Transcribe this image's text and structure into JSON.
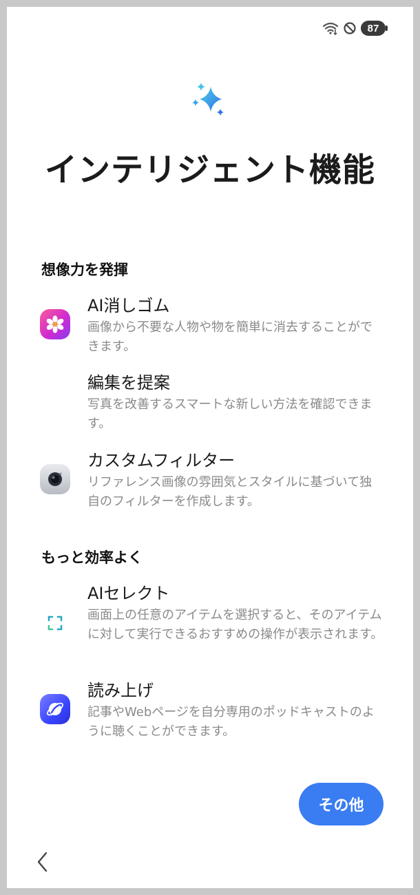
{
  "status_bar": {
    "battery_level": "87",
    "icons": [
      "wifi-icon",
      "do-not-disturb-icon",
      "battery-icon"
    ]
  },
  "header": {
    "title": "インテリジェント機能",
    "icon": "sparkle-icon"
  },
  "sections": [
    {
      "heading": "想像力を発揮",
      "items": [
        {
          "title": "AI消しゴム",
          "description": "画像から不要な人物や物を簡単に消去することができます。",
          "icon": "eraser-flower-icon"
        },
        {
          "title": "編集を提案",
          "description": "写真を改善するスマートな新しい方法を確認できます。",
          "icon": ""
        },
        {
          "title": "カスタムフィルター",
          "description": "リファレンス画像の雰囲気とスタイルに基づいて独自のフィルターを作成します。",
          "icon": "camera-icon"
        }
      ]
    },
    {
      "heading": "もっと効率よく",
      "items": [
        {
          "title": "AIセレクト",
          "description": "画面上の任意のアイテムを選択すると、そのアイテムに対して実行できるおすすめの操作が表示されます。",
          "icon": "select-frame-icon"
        },
        {
          "title": "読み上げ",
          "description": "記事やWebページを自分専用のポッドキャストのように聴くことができます。",
          "icon": "read-aloud-icon"
        }
      ]
    }
  ],
  "footer": {
    "more_label": "その他",
    "back_icon": "back-chevron-icon"
  },
  "colors": {
    "accent": "#3a7cf2",
    "title_text": "#1b1b1b",
    "description_text": "#8a8a8a"
  }
}
